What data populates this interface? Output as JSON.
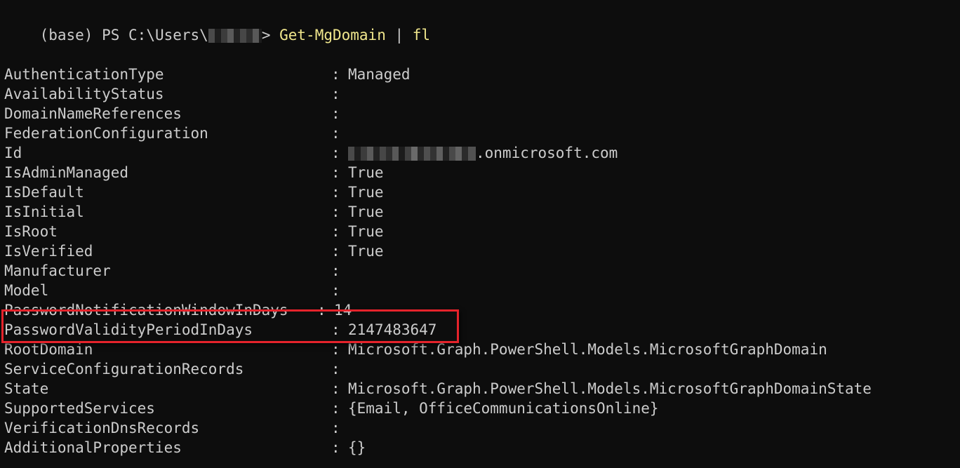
{
  "terminal": {
    "background_color": "#0d0d0d",
    "text_color": "#cccccc",
    "command_color": "#f0e68c",
    "highlight_color": "#e5232b",
    "prompt": {
      "env": "(base) ",
      "shell": "PS ",
      "path": "C:\\Users\\",
      "user_redacted": "[redacted]",
      "caret": "> ",
      "command": "Get-MgDomain",
      "pipe": " | ",
      "format_cmd": "fl"
    },
    "properties": [
      {
        "name": "AuthenticationType",
        "value": "Managed"
      },
      {
        "name": "AvailabilityStatus",
        "value": ""
      },
      {
        "name": "DomainNameReferences",
        "value": ""
      },
      {
        "name": "FederationConfiguration",
        "value": ""
      },
      {
        "name": "Id",
        "value": ".onmicrosoft.com",
        "redacted_prefix": "[redacted]"
      },
      {
        "name": "IsAdminManaged",
        "value": "True"
      },
      {
        "name": "IsDefault",
        "value": "True"
      },
      {
        "name": "IsInitial",
        "value": "True"
      },
      {
        "name": "IsRoot",
        "value": "True"
      },
      {
        "name": "IsVerified",
        "value": "True"
      },
      {
        "name": "Manufacturer",
        "value": ""
      },
      {
        "name": "Model",
        "value": ""
      },
      {
        "name": "PasswordNotificationWindowInDays",
        "value": "14"
      },
      {
        "name": "PasswordValidityPeriodInDays",
        "value": "2147483647"
      },
      {
        "name": "RootDomain",
        "value": "Microsoft.Graph.PowerShell.Models.MicrosoftGraphDomain"
      },
      {
        "name": "ServiceConfigurationRecords",
        "value": ""
      },
      {
        "name": "State",
        "value": "Microsoft.Graph.PowerShell.Models.MicrosoftGraphDomainState"
      },
      {
        "name": "SupportedServices",
        "value": "{Email, OfficeCommunicationsOnline}"
      },
      {
        "name": "VerificationDnsRecords",
        "value": ""
      },
      {
        "name": "AdditionalProperties",
        "value": "{}"
      }
    ]
  }
}
